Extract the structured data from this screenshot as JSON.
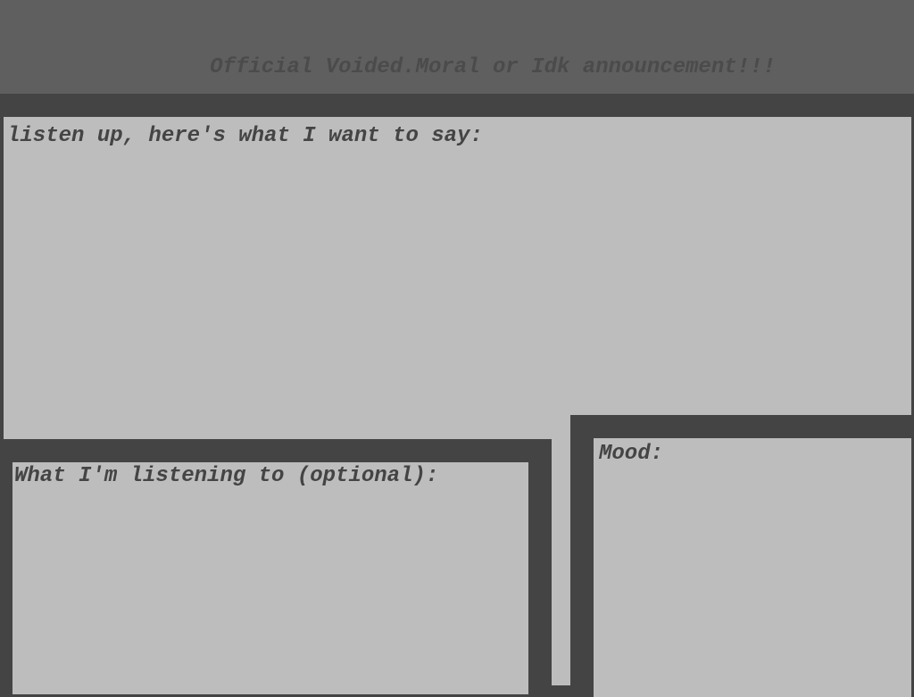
{
  "header": {
    "title": "Official Voided.Moral or Idk announcement!!!"
  },
  "main": {
    "message_label": "listen up, here's what I want to say:",
    "message_value": ""
  },
  "listening": {
    "label": "What I'm listening to (optional):",
    "value": ""
  },
  "mood": {
    "label": "Mood:",
    "value": ""
  },
  "colors": {
    "header_bg": "#5f5f5f",
    "frame_bg": "#444444",
    "box_bg": "#bdbdbd",
    "text": "#444444"
  }
}
